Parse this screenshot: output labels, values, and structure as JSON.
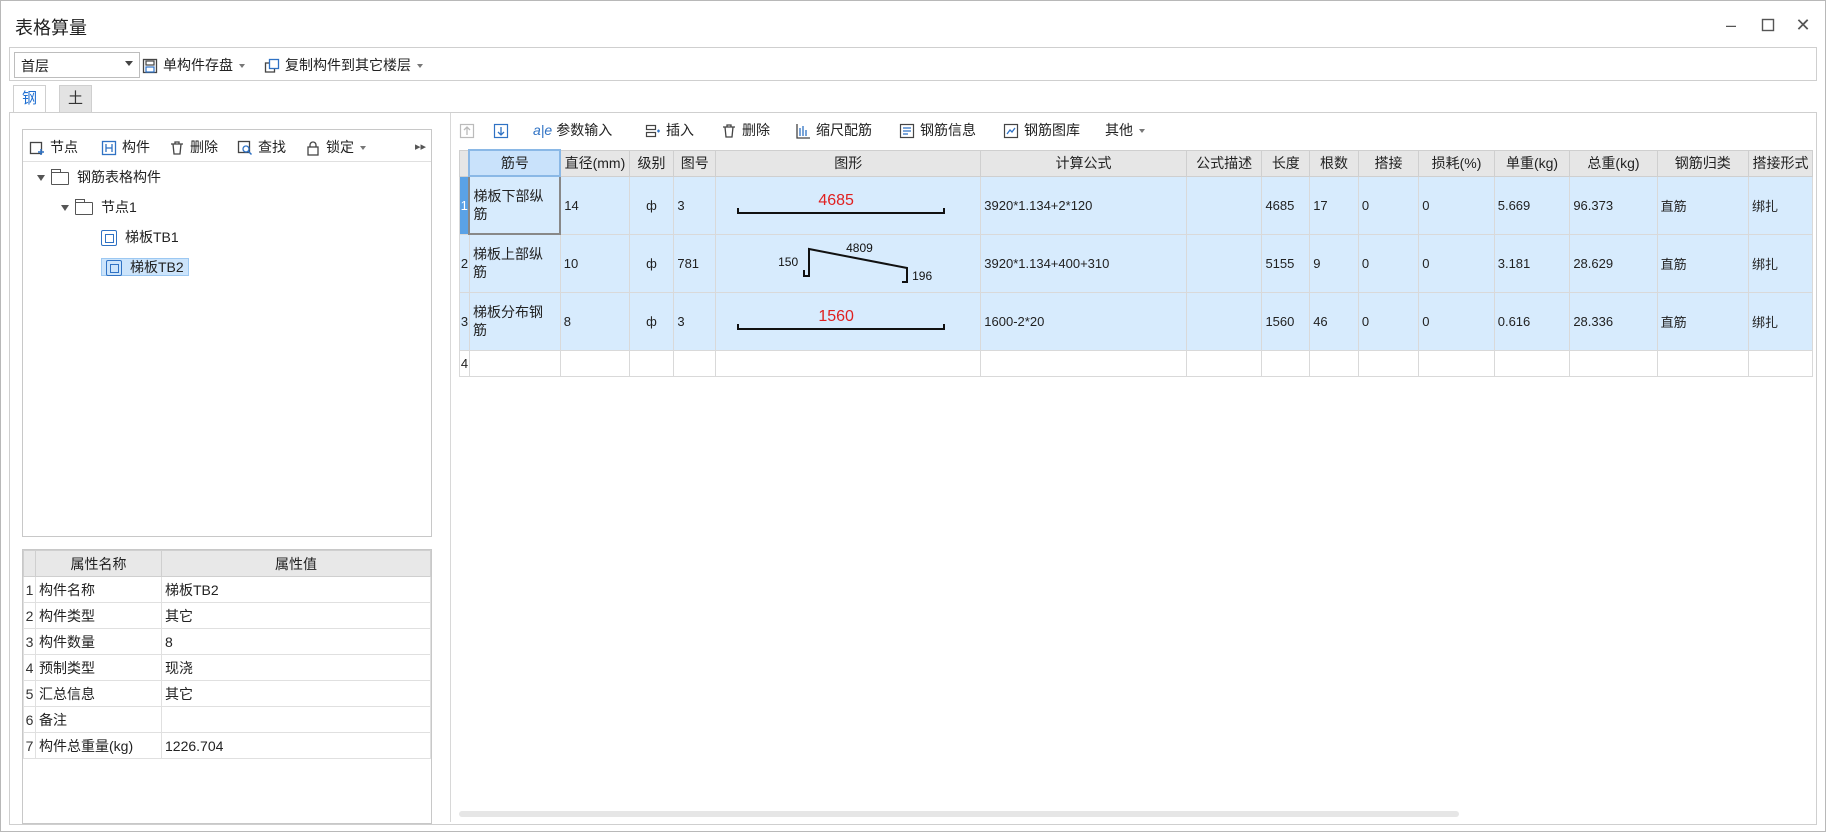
{
  "window": {
    "title": "表格算量"
  },
  "toolbar": {
    "floor": "首层",
    "save_single": "单构件存盘",
    "copy_to_floors": "复制构件到其它楼层"
  },
  "tabs": [
    {
      "label": "钢筋",
      "active": true
    },
    {
      "label": "土建",
      "active": false
    }
  ],
  "tree_toolbar": {
    "node": "节点",
    "component": "构件",
    "delete": "删除",
    "find": "查找",
    "lock": "锁定"
  },
  "tree": {
    "root": "钢筋表格构件",
    "node": "节点1",
    "items": [
      {
        "label": "梯板TB1",
        "selected": false
      },
      {
        "label": "梯板TB2",
        "selected": true
      }
    ]
  },
  "properties": {
    "headers": [
      "属性名称",
      "属性值"
    ],
    "rows": [
      {
        "idx": "1",
        "name": "构件名称",
        "value": "梯板TB2"
      },
      {
        "idx": "2",
        "name": "构件类型",
        "value": "其它"
      },
      {
        "idx": "3",
        "name": "构件数量",
        "value": "8"
      },
      {
        "idx": "4",
        "name": "预制类型",
        "value": "现浇"
      },
      {
        "idx": "5",
        "name": "汇总信息",
        "value": "其它"
      },
      {
        "idx": "6",
        "name": "备注",
        "value": ""
      },
      {
        "idx": "7",
        "name": "构件总重量(kg)",
        "value": "1226.704"
      }
    ]
  },
  "grid_toolbar": {
    "param_input": "参数输入",
    "insert": "插入",
    "delete": "删除",
    "scale_rebar": "缩尺配筋",
    "rebar_info": "钢筋信息",
    "rebar_library": "钢筋图库",
    "other": "其他"
  },
  "grid": {
    "headers": [
      "筋号",
      "直径(mm)",
      "级别",
      "图号",
      "图形",
      "计算公式",
      "公式描述",
      "长度",
      "根数",
      "搭接",
      "损耗(%)",
      "单重(kg)",
      "总重(kg)",
      "钢筋归类",
      "搭接形式"
    ],
    "rows": [
      {
        "idx": "1",
        "name": "梯板下部纵筋",
        "diameter": "14",
        "grade": "ф",
        "fig_no": "3",
        "shape": {
          "type": "straight",
          "length_label": "4685"
        },
        "formula": "3920*1.134+2*120",
        "desc": "",
        "length": "4685",
        "count": "17",
        "lap": "0",
        "loss": "0",
        "unit_weight": "5.669",
        "total_weight": "96.373",
        "category": "直筋",
        "lap_type": "绑扎"
      },
      {
        "idx": "2",
        "name": "梯板上部纵筋",
        "diameter": "10",
        "grade": "ф",
        "fig_no": "781",
        "shape": {
          "type": "bent",
          "left_label": "150",
          "mid_label": "4809",
          "right_label": "196"
        },
        "formula": "3920*1.134+400+310",
        "desc": "",
        "length": "5155",
        "count": "9",
        "lap": "0",
        "loss": "0",
        "unit_weight": "3.181",
        "total_weight": "28.629",
        "category": "直筋",
        "lap_type": "绑扎"
      },
      {
        "idx": "3",
        "name": "梯板分布钢筋",
        "diameter": "8",
        "grade": "ф",
        "fig_no": "3",
        "shape": {
          "type": "straight",
          "length_label": "1560"
        },
        "formula": "1600-2*20",
        "desc": "",
        "length": "1560",
        "count": "46",
        "lap": "0",
        "loss": "0",
        "unit_weight": "0.616",
        "total_weight": "28.336",
        "category": "直筋",
        "lap_type": "绑扎"
      }
    ],
    "empty_row_idx": "4"
  },
  "colors": {
    "selected_row": "#d7ebfd",
    "accent": "#1f6fd1",
    "shape_label": "#e02020"
  },
  "icons": {
    "node_add": "node-add-icon",
    "component_add": "component-add-icon",
    "delete": "trash-icon",
    "find": "find-icon",
    "lock": "lock-icon",
    "move_up": "arrow-up-icon",
    "move_down": "arrow-down-icon"
  }
}
